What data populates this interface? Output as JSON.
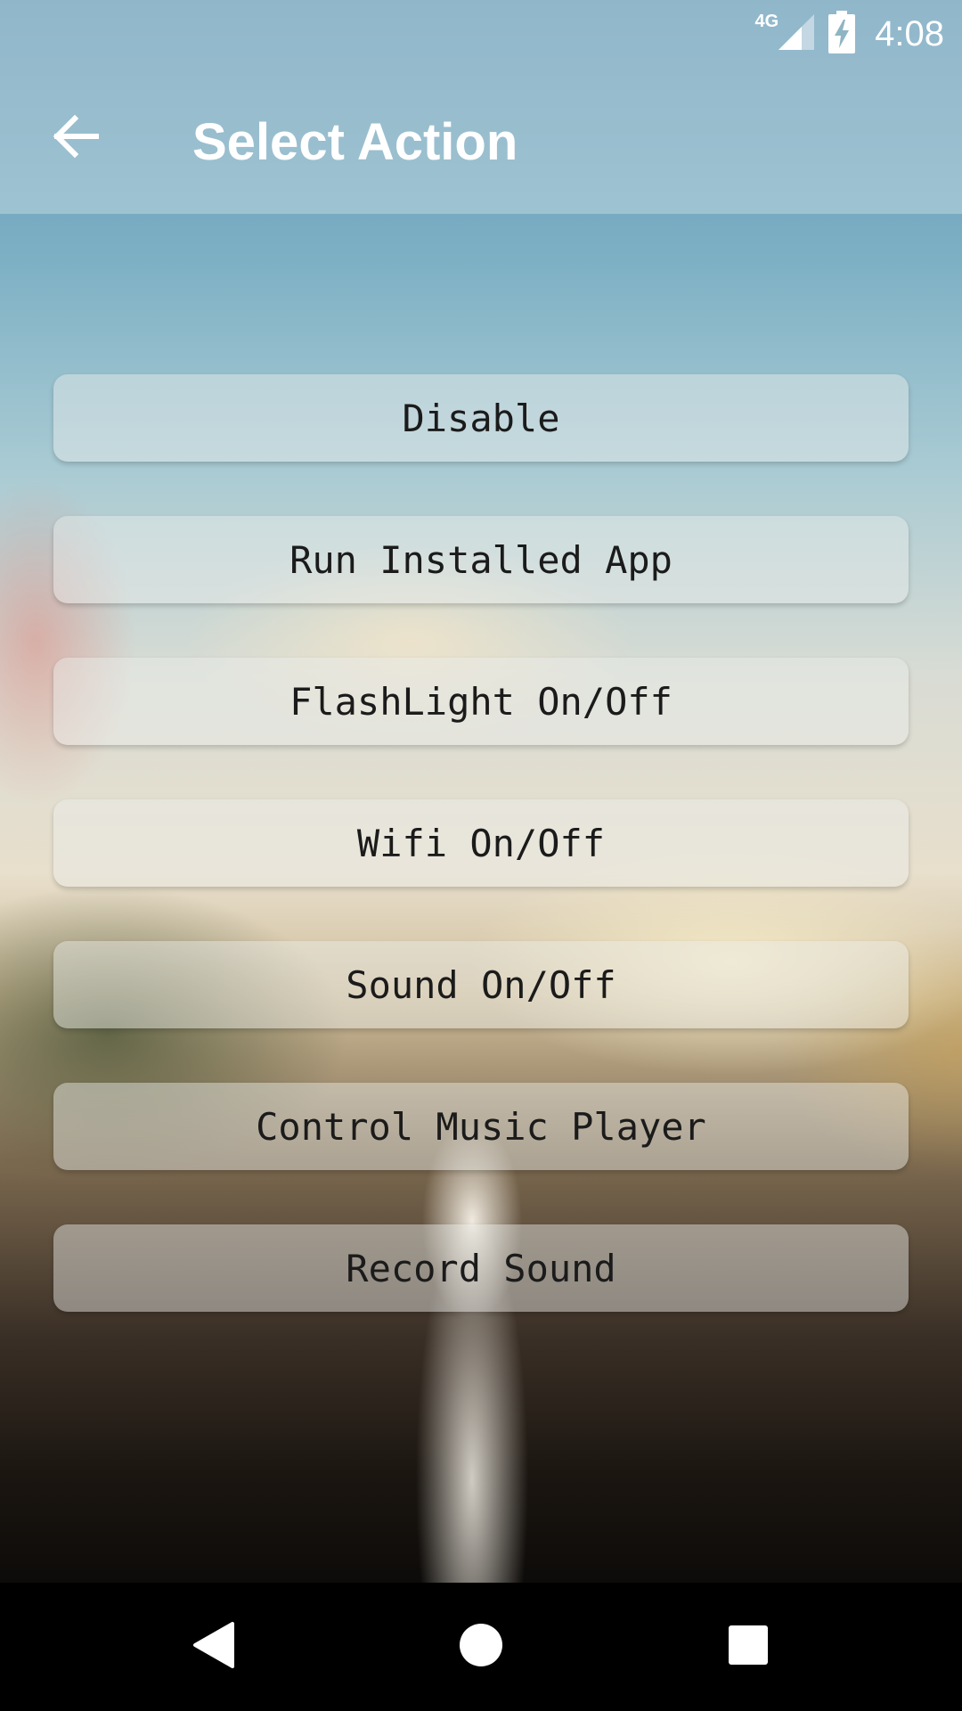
{
  "status_bar": {
    "network_label": "4G",
    "time": "4:08",
    "icons": [
      "signal-icon",
      "battery-charging-icon"
    ]
  },
  "app_bar": {
    "back_icon": "arrow-left-icon",
    "title": "Select Action"
  },
  "actions": [
    {
      "label": "Disable"
    },
    {
      "label": "Run Installed App"
    },
    {
      "label": "FlashLight On/Off"
    },
    {
      "label": "Wifi On/Off"
    },
    {
      "label": "Sound On/Off"
    },
    {
      "label": "Control Music Player"
    },
    {
      "label": "Record Sound"
    }
  ],
  "nav_bar": {
    "icons": [
      "back-triangle-icon",
      "home-circle-icon",
      "recents-square-icon"
    ]
  },
  "colors": {
    "text_light": "#ffffff",
    "button_text": "#1b1b1b",
    "nav_background": "#000000"
  }
}
